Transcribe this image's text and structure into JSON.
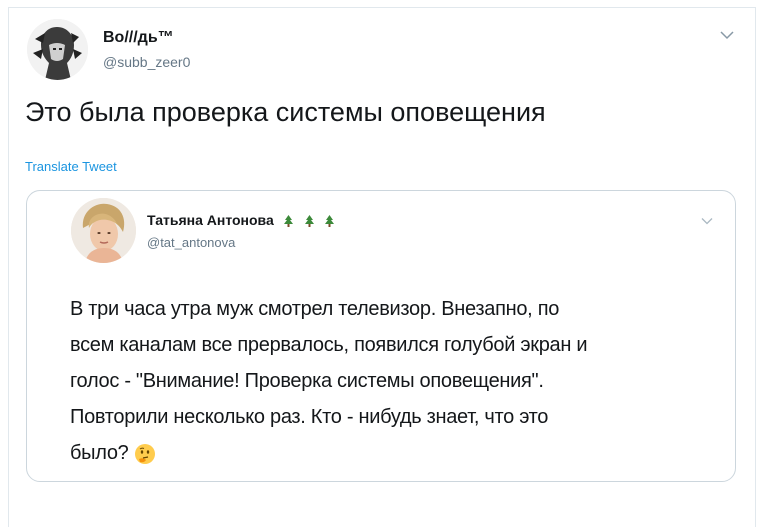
{
  "tweet": {
    "display_name": "Во///дь™",
    "handle": "@subb_zeer0",
    "text": "Это была проверка системы оповещения",
    "translate_label": "Translate Tweet"
  },
  "quoted": {
    "display_name": "Татьяна Антонова",
    "handle": "@tat_antonova",
    "body_lines": [
      "В три часа утра муж смотрел телевизор. Внезапно, по",
      "всем каналам все прервалось, появился голубой экран и",
      "голос - \"Внимание! Проверка системы оповещения\".",
      "Повторили несколько раз. Кто - нибудь знает, что это",
      "было?"
    ],
    "name_icons": [
      "christmas-tree-icon",
      "christmas-tree-icon",
      "christmas-tree-icon"
    ],
    "end_emoji": "thinking-face-icon"
  },
  "colors": {
    "text": "#14171a",
    "secondary": "#657786",
    "link": "#1b95e0",
    "border": "#ccd6dd"
  }
}
